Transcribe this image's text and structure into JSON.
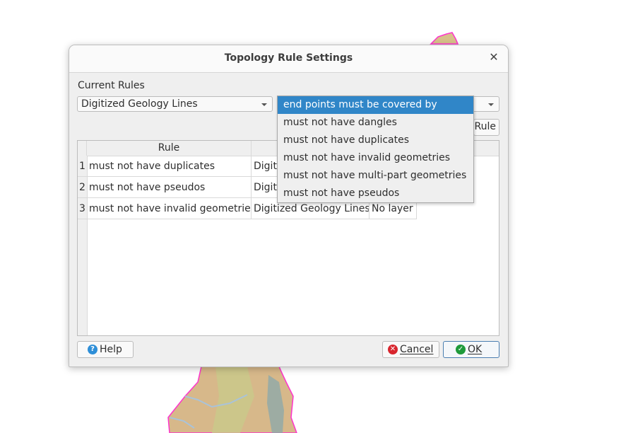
{
  "dialog": {
    "title": "Topology Rule Settings",
    "close_icon": "close-icon",
    "current_rules_label": "Current Rules",
    "layer_combo": {
      "value": "Digitized Geology Lines"
    },
    "rule_combo": {
      "value": "end points must be covered by"
    },
    "add_rule_button_partial_label": "Rule",
    "table": {
      "columns": [
        "Rule",
        "",
        ""
      ],
      "rows": [
        {
          "num": "1",
          "rule": "must not have duplicates",
          "layer1": "Digit",
          "layer2": ""
        },
        {
          "num": "2",
          "rule": "must not have pseudos",
          "layer1": "Digit",
          "layer2": ""
        },
        {
          "num": "3",
          "rule": "must not have invalid geometries",
          "layer1": "Digitized Geology Lines",
          "layer2": "No layer"
        }
      ]
    },
    "buttons": {
      "help": "Help",
      "cancel": "Cancel",
      "ok": "OK"
    }
  },
  "dropdown": {
    "selected_index": 0,
    "options": [
      "end points must be covered by",
      "must not have dangles",
      "must not have duplicates",
      "must not have invalid geometries",
      "must not have multi-part geometries",
      "must not have pseudos"
    ]
  },
  "colors": {
    "accent": "#3086c8",
    "help_icon": "#2e8fd8",
    "cancel_icon": "#d8262e",
    "ok_icon": "#1e9a3a",
    "map_outline": "#ff33cc"
  }
}
